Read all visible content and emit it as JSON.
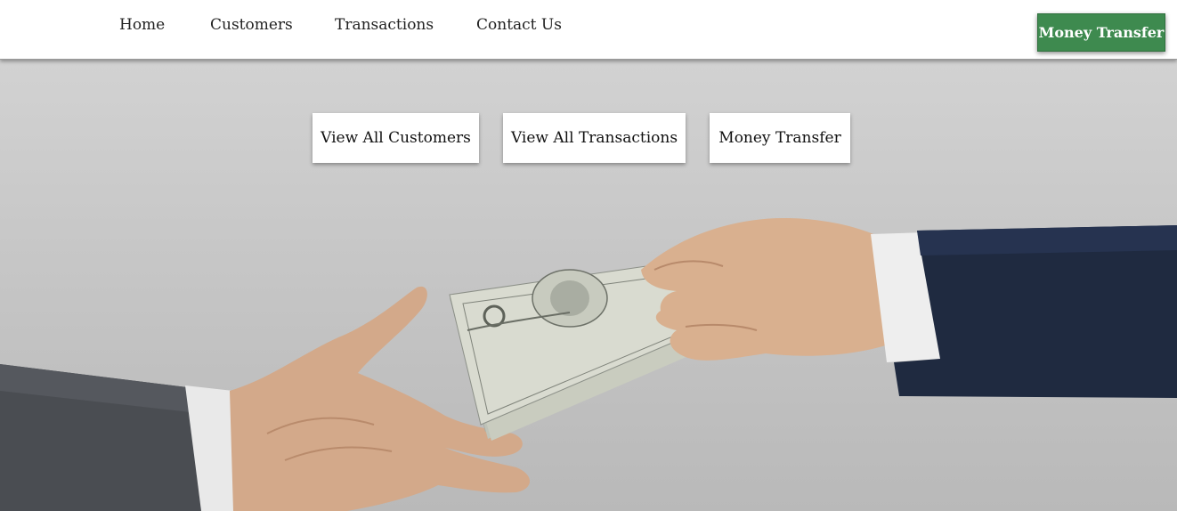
{
  "nav": {
    "links": [
      "Home",
      "Customers",
      "Transactions",
      "Contact Us"
    ],
    "cta_label": "Money Transfer",
    "cta_color": "#3e8a4f"
  },
  "hero": {
    "buttons": [
      "View All Customers",
      "View All Transactions",
      "Money Transfer"
    ],
    "image_subject": "hand-passing-cash-illustration"
  }
}
